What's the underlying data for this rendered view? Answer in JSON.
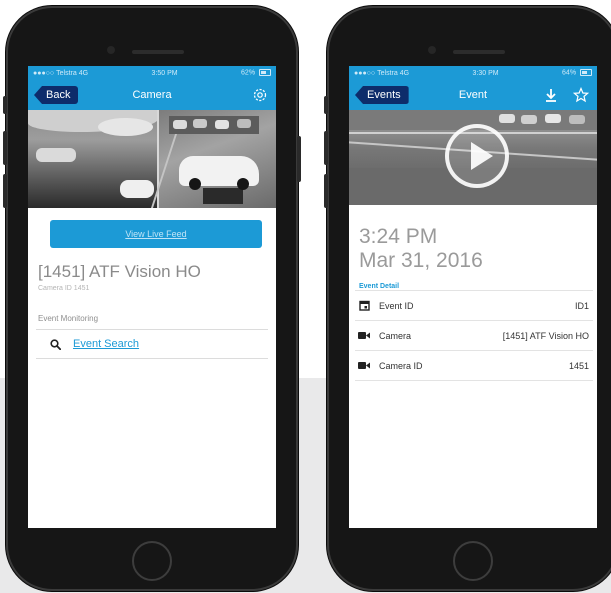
{
  "colors": {
    "accent": "#1c9ad6",
    "back_button": "#0d2c6b",
    "phone_body": "#161616",
    "text_grey": "#9a9a9a"
  },
  "left_phone": {
    "status": {
      "carrier": "Telstra 4G",
      "time": "3:50 PM",
      "battery": "62%"
    },
    "nav": {
      "back_label": "Back",
      "title": "Camera",
      "right_icon": "gear-icon"
    },
    "live_feed_label": "View Live Feed",
    "camera_title": "[1451] ATF Vision HO",
    "camera_id_label": "Camera ID",
    "camera_id_value": "1451",
    "section_label": "Event Monitoring",
    "event_search_label": "Event Search"
  },
  "right_phone": {
    "status": {
      "carrier": "Telstra 4G",
      "time": "3:30 PM",
      "battery": "64%"
    },
    "nav": {
      "back_label": "Events",
      "title": "Event",
      "icons": [
        "download-icon",
        "star-icon"
      ]
    },
    "event_time": "3:24 PM",
    "event_date": "Mar 31, 2016",
    "detail_label": "Event Detail",
    "details": [
      {
        "icon": "calendar-icon",
        "key": "Event ID",
        "value": "ID1"
      },
      {
        "icon": "video-camera-icon",
        "key": "Camera",
        "value": "[1451] ATF Vision HO"
      },
      {
        "icon": "video-camera-icon",
        "key": "Camera ID",
        "value": "1451"
      }
    ]
  }
}
